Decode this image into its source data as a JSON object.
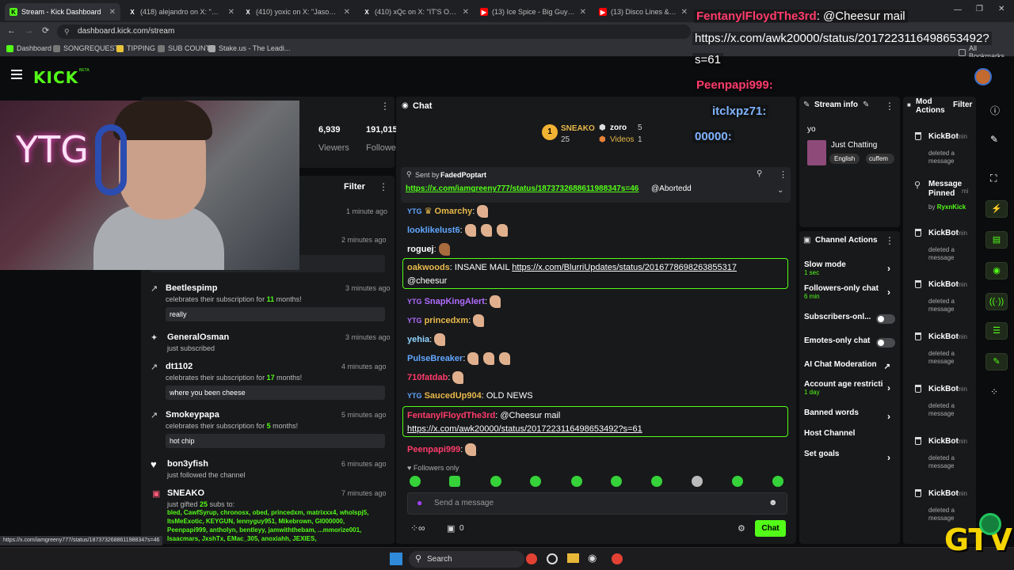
{
  "browser": {
    "tabs": [
      {
        "title": "Stream - Kick Dashboard",
        "icon": "kick-icon",
        "active": true
      },
      {
        "title": "(418) alejandro on X: \"@kick d",
        "icon": "x-icon"
      },
      {
        "title": "(410) yoxic on X: \"Jasontheweer",
        "icon": "x-icon"
      },
      {
        "title": "(410) xQc on X: \"IT'S OVER FOR",
        "icon": "x-icon"
      },
      {
        "title": "(13) Ice Spice - Big Guy (Lyri",
        "icon": "youtube-icon"
      },
      {
        "title": "(13) Disco Lines & Tinashe - No",
        "icon": "youtube-icon"
      }
    ],
    "url": "dashboard.kick.com/stream",
    "bookmarks": [
      "Dashboard",
      "SONGREQUESTS",
      "TIPPING",
      "SUB COUNT",
      "Stake.us - The Leadi..."
    ],
    "all_bookmarks": "All Bookmarks"
  },
  "kick": {
    "logo": "KICK",
    "beta": "BETA"
  },
  "webcam": {
    "text": "YTG"
  },
  "stats": {
    "viewers": "6,939",
    "viewers_label": "Viewers",
    "followers": "191,015",
    "followers_label": "Followe"
  },
  "activity": {
    "filter": "Filter",
    "times_top": [
      "1 minute ago",
      "2 minutes ago"
    ],
    "items": [
      {
        "name": "Beetlespimp",
        "text": "celebrates their subscription for",
        "months": "11",
        "months_suffix": " months!",
        "time": "3 minutes ago",
        "message": "really",
        "icon": "sub-icon"
      },
      {
        "name": "GeneralOsman",
        "text": "just subscribed",
        "time": "3 minutes ago",
        "icon": "star-icon"
      },
      {
        "name": "dt1102",
        "text": "celebrates their subscription for",
        "months": "17",
        "months_suffix": " months!",
        "time": "4 minutes ago",
        "message": "where you been cheese",
        "icon": "sub-icon"
      },
      {
        "name": "Smokeypapa",
        "text": "celebrates their subscription for",
        "months": "5",
        "months_suffix": " months!",
        "time": "5 minutes ago",
        "message": "hot chip",
        "icon": "sub-icon"
      },
      {
        "name": "bon3yfish",
        "text": "just followed the channel",
        "time": "6 minutes ago",
        "icon": "heart-icon"
      },
      {
        "name": "SNEAKO",
        "text": "just gifted",
        "gifted": "25",
        "gifted_suffix": " subs to:",
        "time": "7 minutes ago",
        "icon": "gift-icon",
        "recipients": "bled, CawfSyrup, chronosx, obed, princedxm, matrixxx4, wholspj5, ItsMeExotic, KEYGUN, lennyguy951, Mikebrown, GI000000, Peenpapi999, antholyn, bentleyy, jamwiththebam, ...mmorize001, Isaacmars, JxshTx, EMac_305, anoxiahh, JEXIES,"
      }
    ]
  },
  "chat": {
    "title": "Chat",
    "leader": {
      "name": "SNEAKO",
      "count": "25",
      "rank": "1"
    },
    "leader2": {
      "name": "zoro",
      "count": "5"
    },
    "videos": {
      "label": "Videos",
      "count": "1"
    },
    "pinned": {
      "sent_by_label": "Sent by",
      "sender": "FadedPoptart",
      "link": "https://x.com/iamgreeny777/status/1873732688611988347s=46",
      "mention": "@Abortedd"
    },
    "messages": [
      {
        "user": "Omarchy",
        "text": "",
        "color": "#e8b94a"
      },
      {
        "user": "looklikelust6",
        "text": "",
        "color": "#61a7ff"
      },
      {
        "user": "roguej",
        "text": "",
        "color": "#ffffff"
      },
      {
        "user": "oakwoods",
        "text": "INSANE MAIL ",
        "link": "https://x.com/BlurriUpdates/status/2016778698263855317",
        "after": "@cheesur",
        "color": "#e8b94a"
      },
      {
        "user": "SnapKingAlert",
        "text": "",
        "color": "#b06cff"
      },
      {
        "user": "princedxm",
        "text": "",
        "color": "#e8b94a"
      },
      {
        "user": "yehia",
        "text": "",
        "color": "#8fd3ff"
      },
      {
        "user": "PulseBreaker",
        "text": "",
        "color": "#61a7ff"
      },
      {
        "user": "710fatdab",
        "text": "",
        "color": "#ff3b6b"
      },
      {
        "user": "SaucedUp904",
        "text": "OLD NEWS",
        "color": "#e8b94a"
      },
      {
        "user": "FentanylFloydThe3rd",
        "text": "@Cheesur mail",
        "link": "https://x.com/awk20000/status/2017223116498653492?s=61",
        "color": "#ff3b6b"
      },
      {
        "user": "Peenpapi999",
        "text": "",
        "color": "#ff3b6b"
      }
    ],
    "followers_only": "Followers only",
    "placeholder": "Send a message",
    "points": "0",
    "chat_button": "Chat"
  },
  "stream_info": {
    "title": "Stream info",
    "stream_title": "yo",
    "category": "Just Chatting",
    "tags": [
      "English",
      "cuffem"
    ]
  },
  "channel_actions": {
    "title": "Channel Actions",
    "items": [
      {
        "label": "Slow mode",
        "sub": "1 sec",
        "chevron": true
      },
      {
        "label": "Followers-only chat",
        "sub": "6 min",
        "chevron": true
      },
      {
        "label": "Subscribers-onl...",
        "toggle": true
      },
      {
        "label": "Emotes-only chat",
        "toggle": true
      },
      {
        "label": "AI Chat Moderation",
        "ext": true
      },
      {
        "label": "Account age restricti",
        "sub": "1 day",
        "chevron": true
      },
      {
        "label": "Banned words",
        "chevron": true
      },
      {
        "label": "Host Channel"
      },
      {
        "label": "Set goals",
        "chevron": true
      }
    ]
  },
  "mod_actions": {
    "title": "Mod Actions",
    "filter": "Filter",
    "items": [
      {
        "user": "KickBot",
        "time": "min",
        "desc": "deleted a message"
      },
      {
        "user": "Message Pinned",
        "time": "mi",
        "by_label": "by",
        "by": "RyxnKick",
        "pinned": true
      },
      {
        "user": "KickBot",
        "time": "min",
        "desc": "deleted a message"
      },
      {
        "user": "KickBot",
        "time": "min",
        "desc": "deleted a message"
      },
      {
        "user": "KickBot",
        "time": "min",
        "desc": "deleted a message"
      },
      {
        "user": "KickBot",
        "time": "min",
        "desc": "deleted a message"
      },
      {
        "user": "KickBot",
        "time": "min",
        "desc": "deleted a message"
      },
      {
        "user": "KickBot",
        "time": "min",
        "desc": "deleted a message"
      }
    ]
  },
  "overlay": {
    "user": "FentanylFloydThe3rd",
    "mention": "@Cheesur mail",
    "link": "https://x.com/awk20000/status/2017223116498653492?",
    "link2": "s=61",
    "lines": [
      "Peenpapi999:",
      "itclxpz71:",
      "00000:"
    ]
  },
  "status_url": "https://x.com/iamgreeny777/status/1873732688611988347s=46",
  "taskbar": {
    "search": "Search"
  },
  "watermark": "GTV",
  "colors": {
    "accent": "#53fc18",
    "bg": "#0b0c0e",
    "panel": "#18191b"
  }
}
